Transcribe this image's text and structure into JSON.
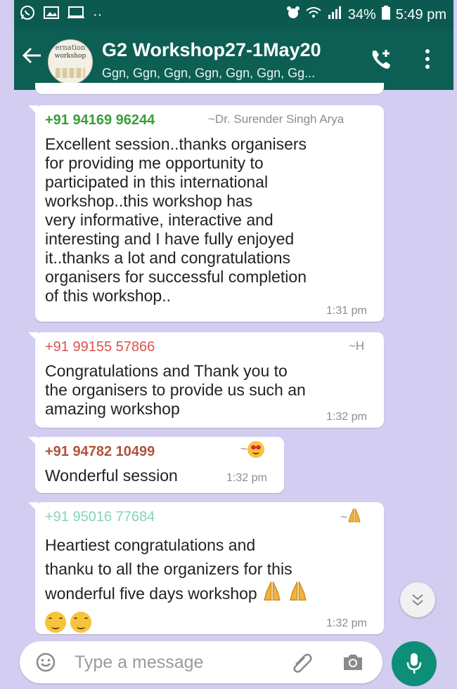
{
  "status_bar": {
    "battery": "34%",
    "time": "5:49 pm"
  },
  "header": {
    "title": "G2 Workshop27-1May20",
    "subtitle": "Ggn, Ggn, Ggn, Ggn, Ggn, Ggn, Gg...",
    "avatar_text_1": "ernation",
    "avatar_text_2": "workshop"
  },
  "messages": [
    {
      "sender": "+91 94169 96244",
      "alias": "~Dr. Surender Singh Arya",
      "sender_color": "#3a9e38",
      "lines": [
        "Excellent session..thanks organisers",
        "for providing me opportunity to",
        "participated in this international",
        "workshop..this workshop has",
        "very informative, interactive and",
        "interesting and I have fully enjoyed",
        "it..thanks a lot and congratulations",
        "organisers for successful completion",
        "of this workshop.."
      ],
      "time": "1:31 pm"
    },
    {
      "sender": "+91 99155 57866",
      "alias": "~H",
      "sender_color": "#d9534f",
      "lines": [
        "Congratulations and Thank you to",
        "the organisers to provide us such an",
        "amazing workshop"
      ],
      "time": "1:32 pm"
    },
    {
      "sender": "+91 94782 10499",
      "alias": "~",
      "sender_color": "#b2533a",
      "lines": [
        "Wonderful session"
      ],
      "time": "1:32 pm"
    },
    {
      "sender": "+91 95016 77684",
      "alias": "~",
      "sender_color": "#86d3c0",
      "lines": [
        "Heartiest congratulations and",
        "thanku to all the organizers for this",
        "wonderful five days workshop"
      ],
      "time": "1:32 pm"
    }
  ],
  "input": {
    "placeholder": "Type a message"
  },
  "colors": {
    "header_bg": "#0d5f53",
    "chat_bg": "#d4cdf2",
    "mic_button": "#0c8f76"
  }
}
